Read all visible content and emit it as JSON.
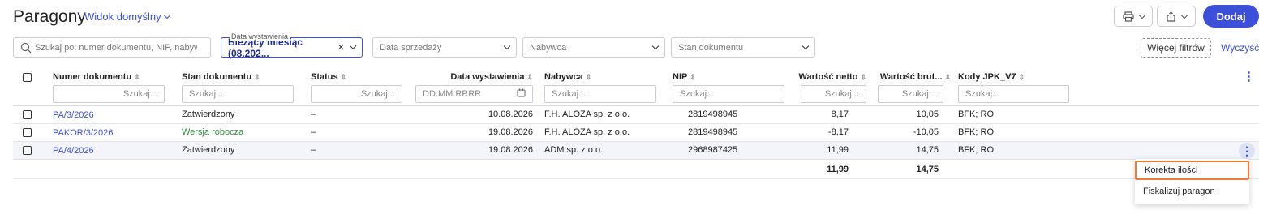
{
  "header": {
    "title": "Paragony",
    "view_label": "Widok domyślny",
    "add_label": "Dodaj"
  },
  "filters": {
    "search_placeholder": "Szukaj po: numer dokumentu, NIP, nabywca",
    "date_issue_label": "Data wystawienia",
    "date_issue_value": "Bieżący miesiąc (08.202...",
    "date_sale": "Data sprzedaży",
    "buyer": "Nabywca",
    "doc_state": "Stan dokumentu",
    "more_filters": "Więcej filtrów",
    "clear": "Wyczyść"
  },
  "table": {
    "columns": [
      "Numer dokumentu",
      "Stan dokumentu",
      "Status",
      "Data wystawienia",
      "Nabywca",
      "NIP",
      "Wartość netto",
      "Wartość brut...",
      "Kody JPK_V7"
    ],
    "search_placeholder": "Szukaj...",
    "date_placeholder": "DD.MM.RRRR",
    "rows": [
      {
        "number": "PA/3/2026",
        "state": "Zatwierdzony",
        "status": "–",
        "date": "10.08.2026",
        "buyer": "F.H. ALOZA sp. z o.o.",
        "nip": "2819498945",
        "net": "8,17",
        "gross": "10,05",
        "jpk": "BFK; RO"
      },
      {
        "number": "PAKOR/3/2026",
        "state": "Wersja robocza",
        "status": "–",
        "date": "19.08.2026",
        "buyer": "F.H. ALOZA sp. z o.o.",
        "nip": "2819498945",
        "net": "-8,17",
        "gross": "-10,05",
        "jpk": "BFK; RO"
      },
      {
        "number": "PA/4/2026",
        "state": "Zatwierdzony",
        "status": "–",
        "date": "19.08.2026",
        "buyer": "ADM sp. z o.o.",
        "nip": "2968987425",
        "net": "11,99",
        "gross": "14,75",
        "jpk": "BFK; RO"
      }
    ],
    "sum_net": "11,99",
    "sum_gross": "14,75"
  },
  "context_menu": {
    "items": [
      "Korekta ilości",
      "Fiskalizuj paragon"
    ]
  },
  "colors": {
    "accent": "#3b4fd8",
    "draft": "#2e8b3a",
    "highlight": "#f07a3a"
  },
  "icons": [
    "chevron-down-icon",
    "print-icon",
    "export-icon",
    "search-icon",
    "close-icon",
    "calendar-icon",
    "kebab-icon"
  ]
}
